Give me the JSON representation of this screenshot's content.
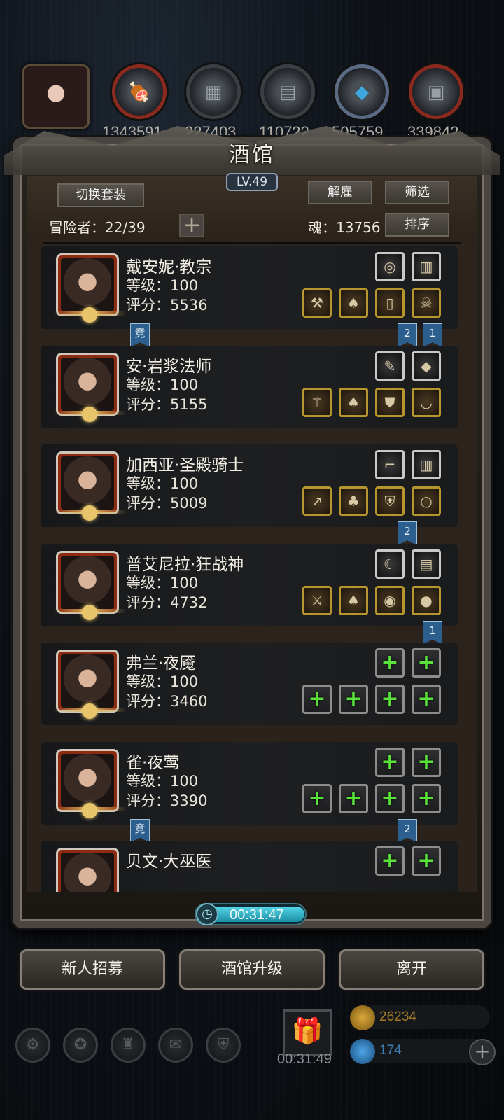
{
  "top_resources": [
    {
      "icon": "meat-icon",
      "value": "1343591"
    },
    {
      "icon": "wood-icon",
      "value": "227403"
    },
    {
      "icon": "iron-icon",
      "value": "110722"
    },
    {
      "icon": "crystal-icon",
      "value": "505759"
    },
    {
      "icon": "stone-icon",
      "value": "339842"
    }
  ],
  "tavern": {
    "title": "酒馆",
    "level": "LV.49",
    "switch_outfit": "切换套装",
    "dismiss": "解雇",
    "filter": "筛选",
    "sort": "排序",
    "adventurers_label": "冒险者：22/39",
    "soul_label": "魂：13756"
  },
  "heroes": [
    {
      "name": "戴安妮·教宗",
      "level": "等级：100",
      "score": "评分：5536",
      "top_slots": [
        "amulet-icon",
        "scroll-icon"
      ],
      "bottom_slots": [
        "hammer-icon",
        "cloak-icon",
        "bracer-icon",
        "mask-icon"
      ],
      "flags": [
        {
          "text": "竞",
          "pos": "left"
        },
        {
          "text": "2",
          "pos": "r2"
        },
        {
          "text": "1",
          "pos": "r1"
        }
      ]
    },
    {
      "name": "安·岩浆法师",
      "level": "等级：100",
      "score": "评分：5155",
      "top_slots": [
        "feather-icon",
        "gem-icon"
      ],
      "bottom_slots": [
        "staff-icon",
        "cloak-icon",
        "armor-icon",
        "necklace-icon"
      ],
      "flags": []
    },
    {
      "name": "加西亚·圣殿骑士",
      "level": "等级：100",
      "score": "评分：5009",
      "top_slots": [
        "gun-icon",
        "scroll-icon"
      ],
      "bottom_slots": [
        "spear-icon",
        "demon-armor-icon",
        "shield-icon",
        "ring-icon"
      ],
      "flags": [
        {
          "text": "2",
          "pos": "r2"
        }
      ]
    },
    {
      "name": "普艾尼拉·狂战神",
      "level": "等级：100",
      "score": "评分：4732",
      "top_slots": [
        "fang-icon",
        "tome-icon"
      ],
      "bottom_slots": [
        "axe-icon",
        "cloak-icon",
        "ruby-ring-icon",
        "orb-icon"
      ],
      "flags": [
        {
          "text": "1",
          "pos": "r1"
        }
      ]
    },
    {
      "name": "弗兰·夜魇",
      "level": "等级：100",
      "score": "评分：3460",
      "top_slots": [
        "empty",
        "empty"
      ],
      "bottom_slots": [
        "empty",
        "empty",
        "empty",
        "empty"
      ],
      "flags": []
    },
    {
      "name": "雀·夜莺",
      "level": "等级：100",
      "score": "评分：3390",
      "top_slots": [
        "empty",
        "empty"
      ],
      "bottom_slots": [
        "empty",
        "empty",
        "empty",
        "empty"
      ],
      "flags": [
        {
          "text": "竞",
          "pos": "left"
        },
        {
          "text": "2",
          "pos": "r2"
        }
      ]
    },
    {
      "name": "贝文·大巫医",
      "level": "",
      "score": "",
      "top_slots": [
        "empty",
        "empty"
      ],
      "bottom_slots": [],
      "flags": []
    }
  ],
  "timer": "00:31:47",
  "actions": {
    "recruit": "新人招募",
    "upgrade": "酒馆升级",
    "leave": "离开"
  },
  "bottom_bar": {
    "gift_timer": "00:31:49",
    "gold": "26234",
    "diamond": "174"
  }
}
